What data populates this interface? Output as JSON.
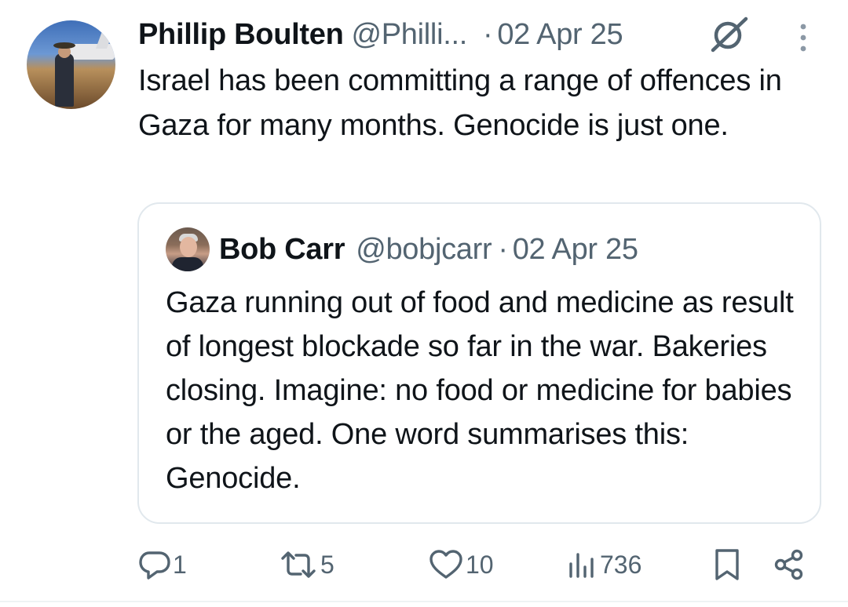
{
  "post": {
    "author_name": "Phillip Boulten",
    "author_handle": "@Philli...",
    "separator": "·",
    "date": "02 Apr 25",
    "text": "Israel has been committing a range of offences in Gaza for many months. Genocide is just one."
  },
  "quoted_post": {
    "author_name": "Bob Carr",
    "author_handle": "@bobjcarr",
    "separator": "·",
    "date": "02 Apr 25",
    "text": "Gaza running out of food and medicine as result of longest blockade so far in the war. Bakeries closing. Imagine: no food or medicine for babies or the aged. One word summarises this: Genocide."
  },
  "actions": {
    "replies": "1",
    "reposts": "5",
    "likes": "10",
    "views": "736"
  },
  "icons": {
    "grok": "grok-icon",
    "more": "more-vertical-icon",
    "reply": "reply-icon",
    "repost": "repost-icon",
    "like": "heart-icon",
    "views": "views-icon",
    "bookmark": "bookmark-icon",
    "share": "share-icon"
  },
  "colors": {
    "text": "#0f1419",
    "secondary": "#536471",
    "border": "#e1e8ed"
  }
}
